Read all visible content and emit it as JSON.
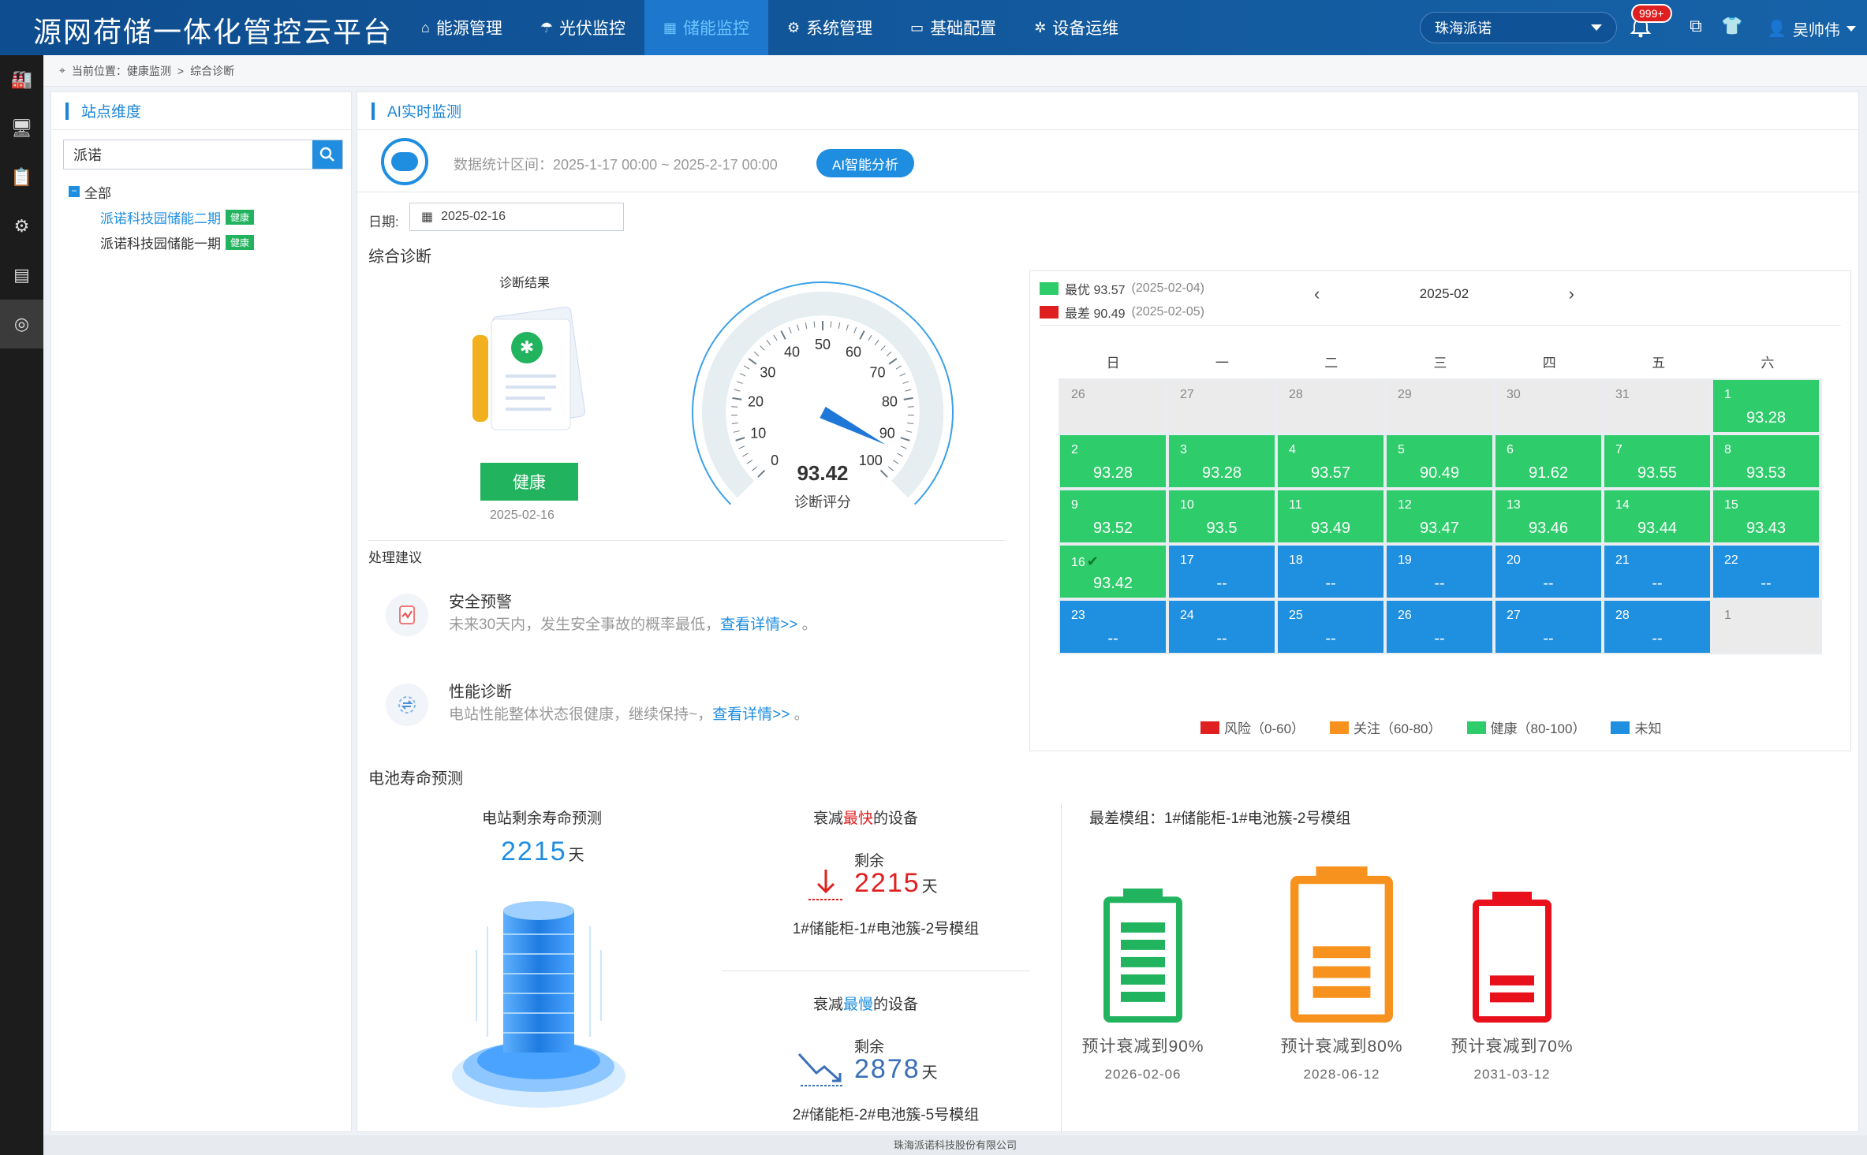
{
  "app": {
    "title": "源网荷储一体化管控云平台"
  },
  "nav": [
    {
      "label": "能源管理",
      "icon": "house-icon"
    },
    {
      "label": "光伏监控",
      "icon": "umbrella-icon"
    },
    {
      "label": "储能监控",
      "icon": "battery-icon"
    },
    {
      "label": "系统管理",
      "icon": "gear-icon"
    },
    {
      "label": "基础配置",
      "icon": "monitor-icon"
    },
    {
      "label": "设备运维",
      "icon": "wrench-icon"
    }
  ],
  "nav_active": "储能监控",
  "station_select": {
    "value": "珠海派诺"
  },
  "notifications": {
    "badge": "999+"
  },
  "user": {
    "name": "吴帅伟"
  },
  "breadcrumb": {
    "text": "当前位置：健康监测",
    "sep": ">",
    "current": "综合诊断"
  },
  "left_panel": {
    "title": "站点维度",
    "search_value": "派诺",
    "tree_root": "全部",
    "stations": [
      {
        "name": "派诺科技园储能二期",
        "tag": "健康",
        "active": true
      },
      {
        "name": "派诺科技园储能一期",
        "tag": "健康",
        "active": false
      }
    ]
  },
  "main": {
    "title": "AI实时监测",
    "stat_range": "数据统计区间：2025-1-17 00:00 ~ 2025-2-17 00:00",
    "ai_button": "AI智能分析",
    "date_label": "日期:",
    "date_value": "2025-02-16"
  },
  "diagnosis": {
    "section_title": "综合诊断",
    "result_label": "诊断结果",
    "status": "健康",
    "date": "2025-02-16",
    "score": "93.42",
    "score_num": 93.42,
    "score_label": "诊断评分",
    "gauge_ticks": [
      "0",
      "10",
      "20",
      "30",
      "40",
      "50",
      "60",
      "70",
      "80",
      "90",
      "100"
    ]
  },
  "advice": {
    "title": "处理建议",
    "items": [
      {
        "title": "安全预警",
        "desc": "未来30天内，发生安全事故的概率最低，",
        "link": "查看详情>>",
        "tail": "。"
      },
      {
        "title": "性能诊断",
        "desc": "电站性能整体状态很健康，继续保持~，",
        "link": "查看详情>>",
        "tail": "。"
      }
    ]
  },
  "calendar": {
    "best": {
      "label": "最优 93.57",
      "date": "(2025-02-04)",
      "color": "#2ecc6b"
    },
    "worst": {
      "label": "最差 90.49",
      "date": "(2025-02-05)",
      "color": "#e02020"
    },
    "month": "2025-02",
    "weekdays": [
      "日",
      "一",
      "二",
      "三",
      "四",
      "五",
      "六"
    ],
    "cells": [
      {
        "d": "26",
        "s": "",
        "t": "grey"
      },
      {
        "d": "27",
        "s": "",
        "t": "grey"
      },
      {
        "d": "28",
        "s": "",
        "t": "grey"
      },
      {
        "d": "29",
        "s": "",
        "t": "grey"
      },
      {
        "d": "30",
        "s": "",
        "t": "grey"
      },
      {
        "d": "31",
        "s": "",
        "t": "grey"
      },
      {
        "d": "1",
        "s": "93.28",
        "t": "green"
      },
      {
        "d": "2",
        "s": "93.28",
        "t": "green"
      },
      {
        "d": "3",
        "s": "93.28",
        "t": "green"
      },
      {
        "d": "4",
        "s": "93.57",
        "t": "green"
      },
      {
        "d": "5",
        "s": "90.49",
        "t": "green"
      },
      {
        "d": "6",
        "s": "91.62",
        "t": "green"
      },
      {
        "d": "7",
        "s": "93.55",
        "t": "green"
      },
      {
        "d": "8",
        "s": "93.53",
        "t": "green"
      },
      {
        "d": "9",
        "s": "93.52",
        "t": "green"
      },
      {
        "d": "10",
        "s": "93.5",
        "t": "green"
      },
      {
        "d": "11",
        "s": "93.49",
        "t": "green"
      },
      {
        "d": "12",
        "s": "93.47",
        "t": "green"
      },
      {
        "d": "13",
        "s": "93.46",
        "t": "green"
      },
      {
        "d": "14",
        "s": "93.44",
        "t": "green"
      },
      {
        "d": "15",
        "s": "93.43",
        "t": "green"
      },
      {
        "d": "16",
        "s": "93.42",
        "t": "green",
        "selected": true
      },
      {
        "d": "17",
        "s": "--",
        "t": "blue"
      },
      {
        "d": "18",
        "s": "--",
        "t": "blue"
      },
      {
        "d": "19",
        "s": "--",
        "t": "blue"
      },
      {
        "d": "20",
        "s": "--",
        "t": "blue"
      },
      {
        "d": "21",
        "s": "--",
        "t": "blue"
      },
      {
        "d": "22",
        "s": "--",
        "t": "blue"
      },
      {
        "d": "23",
        "s": "--",
        "t": "blue"
      },
      {
        "d": "24",
        "s": "--",
        "t": "blue"
      },
      {
        "d": "25",
        "s": "--",
        "t": "blue"
      },
      {
        "d": "26",
        "s": "--",
        "t": "blue"
      },
      {
        "d": "27",
        "s": "--",
        "t": "blue"
      },
      {
        "d": "28",
        "s": "--",
        "t": "blue"
      },
      {
        "d": "1",
        "s": "",
        "t": "grey"
      }
    ],
    "legend": [
      {
        "label": "风险（0-60）",
        "color": "#e02020"
      },
      {
        "label": "关注（60-80）",
        "color": "#f7921e"
      },
      {
        "label": "健康（80-100）",
        "color": "#2ecc6b"
      },
      {
        "label": "未知",
        "color": "#1f8fe0"
      }
    ]
  },
  "battery_life": {
    "title": "电池寿命预测",
    "remaining_title": "电站剩余寿命预测",
    "remaining_value": "2215",
    "unit": "天",
    "fast": {
      "pre": "衰减",
      "hl": "最快",
      "post": "的设备",
      "rem_label": "剩余",
      "value": "2215",
      "module": "1#储能柜-1#电池簇-2号模组"
    },
    "slow": {
      "pre": "衰减",
      "hl": "最慢",
      "post": "的设备",
      "rem_label": "剩余",
      "value": "2878",
      "module": "2#储能柜-2#电池簇-5号模组"
    },
    "worst_module": "最差模组：1#储能柜-1#电池簇-2号模组",
    "predictions": [
      {
        "caption": "预计衰减到90%",
        "date": "2026-02-06",
        "color": "#22b35e",
        "level": 0.9
      },
      {
        "caption": "预计衰减到80%",
        "date": "2028-06-12",
        "color": "#f7921e",
        "level": 0.8
      },
      {
        "caption": "预计衰减到70%",
        "date": "2031-03-12",
        "color": "#e8101a",
        "level": 0.7
      }
    ]
  },
  "footer": {
    "text": "珠海派诺科技股份有限公司"
  }
}
